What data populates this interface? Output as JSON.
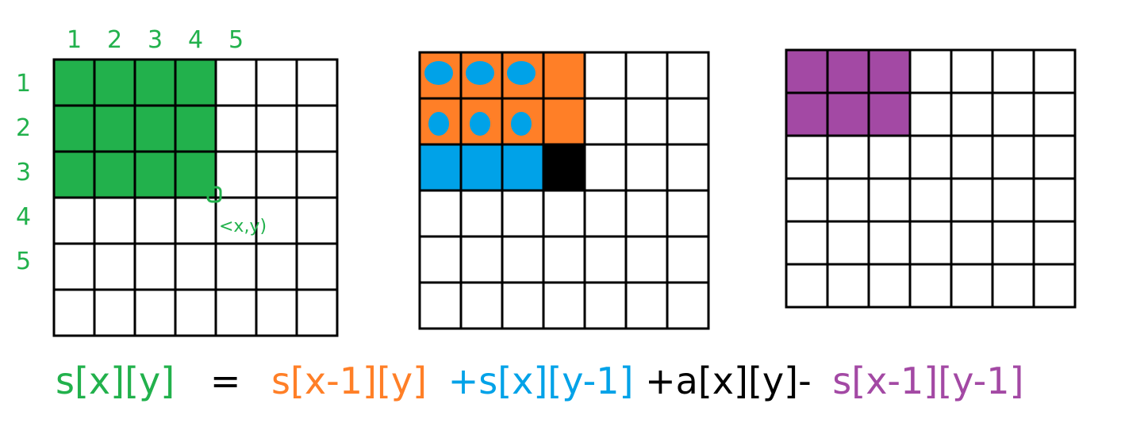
{
  "colors": {
    "green": "#22b14c",
    "orange": "#ff7f27",
    "blue": "#00a2e8",
    "purple": "#a349a4",
    "black": "#000000",
    "white": "#ffffff"
  },
  "grid1": {
    "row_labels": [
      "1",
      "2",
      "3",
      "4",
      "5"
    ],
    "col_labels": [
      "1",
      "2",
      "3",
      "4",
      "5"
    ],
    "point_label": "<x,y)",
    "fill": "green",
    "filled_rows": 3,
    "filled_cols": 4
  },
  "grid2": {
    "orange_rows": 2,
    "orange_cols": 4,
    "blue_row": 3,
    "blue_cols": 3,
    "black_cell": [
      3,
      4
    ]
  },
  "grid3": {
    "fill": "purple",
    "filled_rows": 2,
    "filled_cols": 3
  },
  "formula": [
    {
      "text": "s[x][y]",
      "color": "green"
    },
    {
      "text": "=",
      "color": "black"
    },
    {
      "text": "s[x-1][y]",
      "color": "orange"
    },
    {
      "text": "+s[x][y-1]",
      "color": "blue"
    },
    {
      "text": "+a[x][y]-",
      "color": "black"
    },
    {
      "text": "s[x-1][y-1]",
      "color": "purple"
    }
  ]
}
